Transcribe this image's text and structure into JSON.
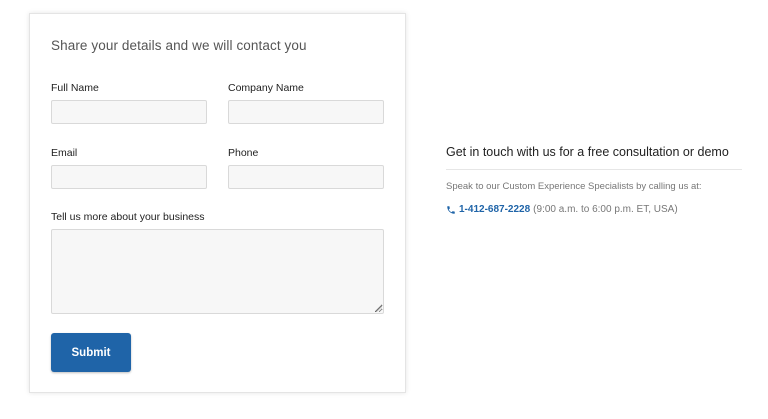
{
  "form": {
    "heading": "Share your details and we will contact you",
    "full_name_label": "Full Name",
    "full_name_value": "",
    "company_name_label": "Company Name",
    "company_name_value": "",
    "email_label": "Email",
    "email_value": "",
    "phone_label": "Phone",
    "phone_value": "",
    "business_label": "Tell us more about your business",
    "business_value": "",
    "submit_label": "Submit"
  },
  "contact": {
    "title": "Get in touch with us for a free consultation or demo",
    "description": "Speak to our Custom Experience Specialists by calling us at:",
    "phone_icon": "phone-icon",
    "phone_number": "1-412-687-2228",
    "hours": "(9:00 a.m. to 6:00 p.m. ET, USA)"
  },
  "colors": {
    "accent": "#1f64a8",
    "input_bg": "#f7f7f7",
    "input_border": "#d9d9d9",
    "muted_text": "#777777"
  }
}
